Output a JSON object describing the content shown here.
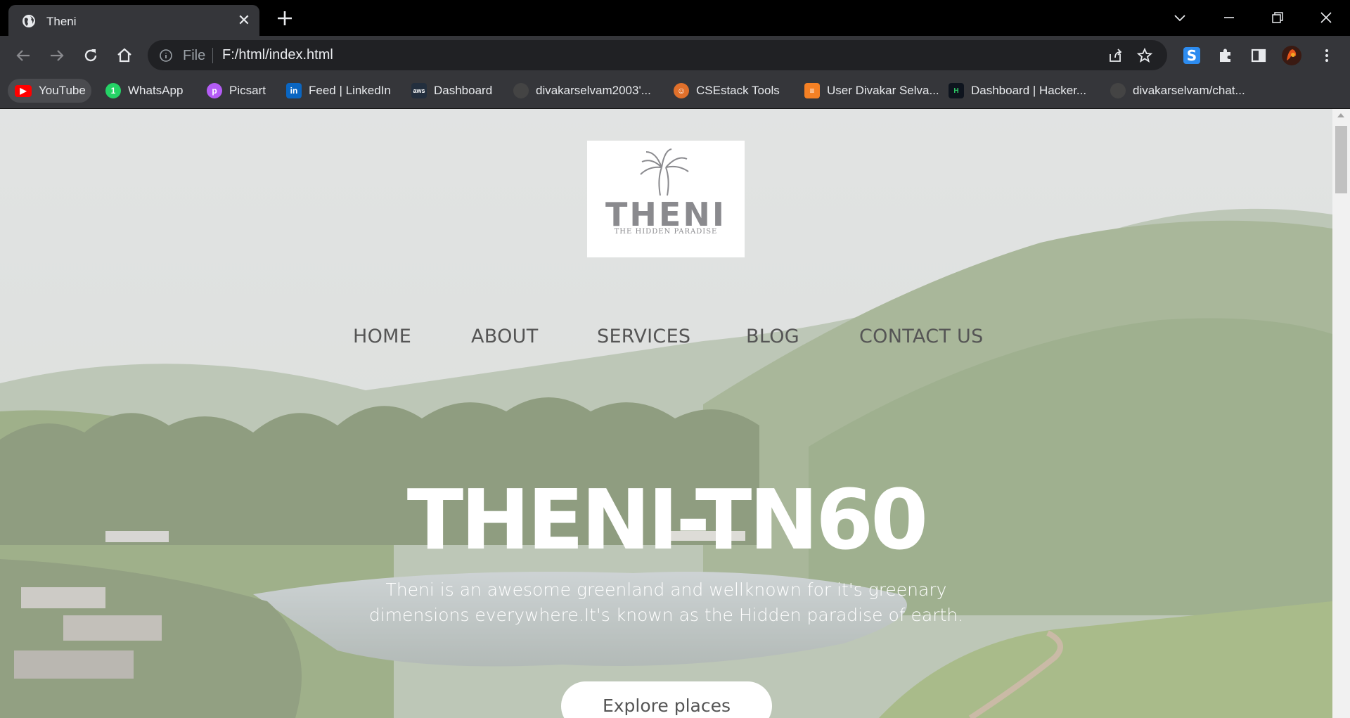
{
  "browser": {
    "tab": {
      "title": "Theni",
      "close_glyph": "✕"
    },
    "omnibox": {
      "scheme_label": "File",
      "url": "F:/html/index.html"
    },
    "bookmarks": [
      {
        "label": "YouTube",
        "icon": "youtube-icon",
        "color": "#ff0000"
      },
      {
        "label": "WhatsApp",
        "icon": "whatsapp-icon",
        "color": "#25d366"
      },
      {
        "label": "Picsart",
        "icon": "picsart-icon",
        "color": "#b45cf5"
      },
      {
        "label": "Feed | LinkedIn",
        "icon": "linkedin-icon",
        "color": "#0a66c2"
      },
      {
        "label": "Dashboard",
        "icon": "aws-icon",
        "color": "#232f3e"
      },
      {
        "label": "divakarselvam2003'...",
        "icon": "github-icon",
        "color": "#444444"
      },
      {
        "label": "CSEstack Tools",
        "icon": "csestack-icon",
        "color": "#e0702b"
      },
      {
        "label": "User Divakar Selva...",
        "icon": "stackoverflow-icon",
        "color": "#f48024"
      },
      {
        "label": "Dashboard | Hacker...",
        "icon": "hackerrank-icon",
        "color": "#0e141e"
      },
      {
        "label": "divakarselvam/chat...",
        "icon": "github-icon",
        "color": "#444444"
      }
    ]
  },
  "page": {
    "logo": {
      "wordmark": "THENI",
      "tagline": "THE HIDDEN PARADISE"
    },
    "nav": [
      "HOME",
      "ABOUT",
      "SERVICES",
      "BLOG",
      "CONTACT US"
    ],
    "headline": "THENI-TN60",
    "tagline": "Theni is an awesome greenland and wellknown for it's greenary dimensions everywhere.It's known as the Hidden paradise of earth.",
    "cta": "Explore places"
  }
}
